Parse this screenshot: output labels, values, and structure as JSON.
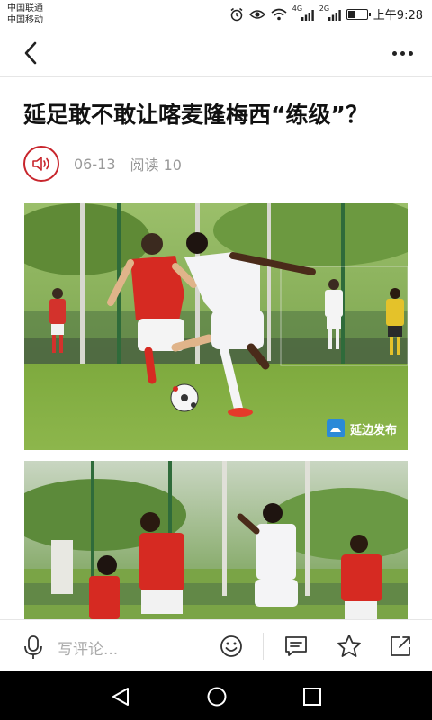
{
  "status_bar": {
    "carrier1": "中国联通",
    "carrier2": "中国移动",
    "network1": "4G",
    "network2": "2G",
    "time": "上午9:28",
    "battery_level": 0.35
  },
  "header": {
    "back_icon": "chevron-left-icon",
    "more_icon": "more-horizontal-icon"
  },
  "article": {
    "title": "延足敢不敢让喀麦隆梅西“练级”？",
    "date": "06-13",
    "read_count": "阅读 10",
    "audio_icon": "speaker-icon",
    "accent_color": "#c8252c"
  },
  "photos": [
    {
      "watermark": "延边发布"
    },
    {}
  ],
  "comment_bar": {
    "placeholder": "写评论..."
  },
  "nav_bar": {
    "icons": [
      "back-triangle-icon",
      "home-circle-icon",
      "recents-square-icon"
    ]
  }
}
